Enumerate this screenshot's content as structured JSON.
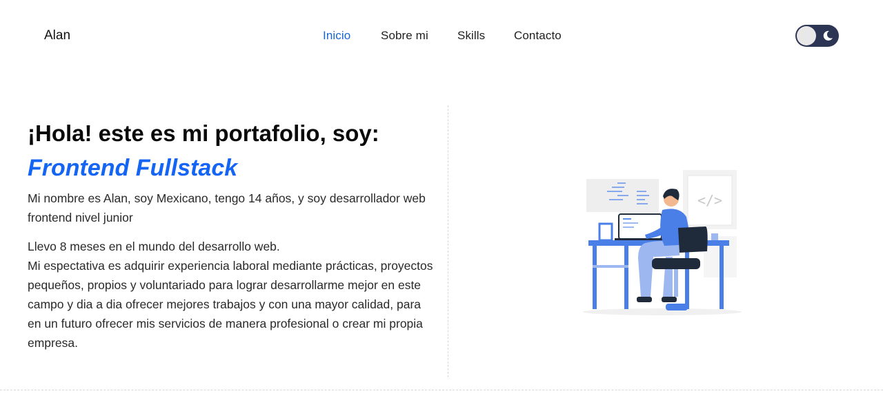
{
  "header": {
    "brand": "Alan",
    "nav": [
      {
        "label": "Inicio",
        "active": true
      },
      {
        "label": "Sobre mi",
        "active": false
      },
      {
        "label": "Skills",
        "active": false
      },
      {
        "label": "Contacto",
        "active": false
      }
    ],
    "theme_toggle": {
      "icon": "moon-icon",
      "state": "dark-mode-off"
    }
  },
  "hero": {
    "title": "¡Hola! este es mi portafolio, soy:",
    "role": "Frontend Fullstack",
    "intro": "Mi nombre es Alan, soy Mexicano, tengo 14 años, y soy desarrollador web frontend nivel junior",
    "lines": [
      "Llevo 8 meses en el mundo del desarrollo web.",
      "Mi espectativa es adquirir experiencia laboral mediante prácticas, proyectos pequeños, propios y voluntariado para lograr desarrollarme mejor en este campo y dia a dia ofrecer mejores trabajos y con una mayor calidad, para en un futuro ofrecer mis servicios de manera profesional o crear mi propia empresa."
    ],
    "illustration_code_label": "</>"
  },
  "colors": {
    "accent": "#1565f5",
    "nav_active": "#1565d8",
    "toggle_bg": "#2c3553"
  }
}
